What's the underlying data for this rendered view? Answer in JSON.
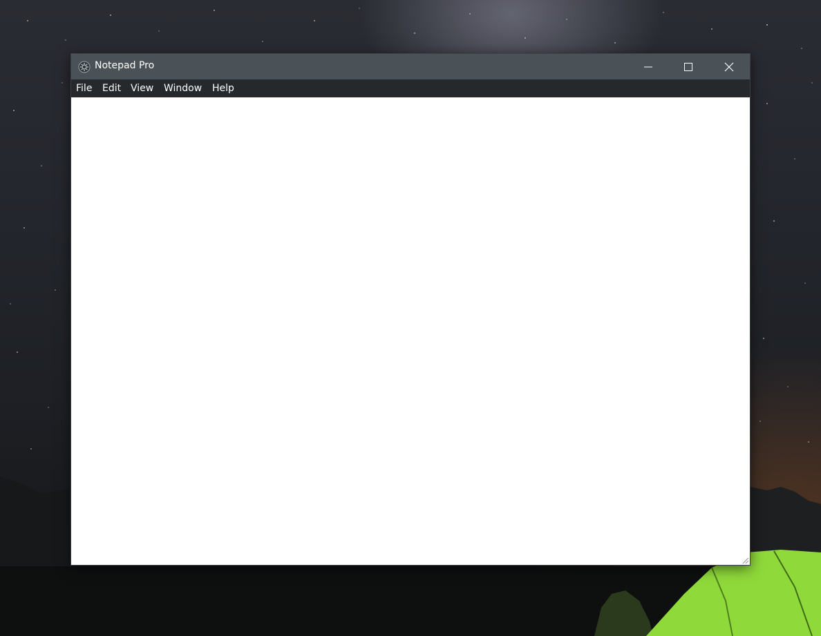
{
  "window": {
    "title": "Notepad Pro",
    "icon": "app-gear-icon",
    "controls": [
      "minimize-icon",
      "maximize-icon",
      "close-icon"
    ]
  },
  "menu": {
    "items": [
      "File",
      "Edit",
      "View",
      "Window",
      "Help"
    ]
  },
  "editor": {
    "content": ""
  },
  "colors": {
    "titlebar": "#4a5257",
    "menubar": "#25292c",
    "editor_background": "#ffffff",
    "tent_green": "#8fd93a"
  }
}
